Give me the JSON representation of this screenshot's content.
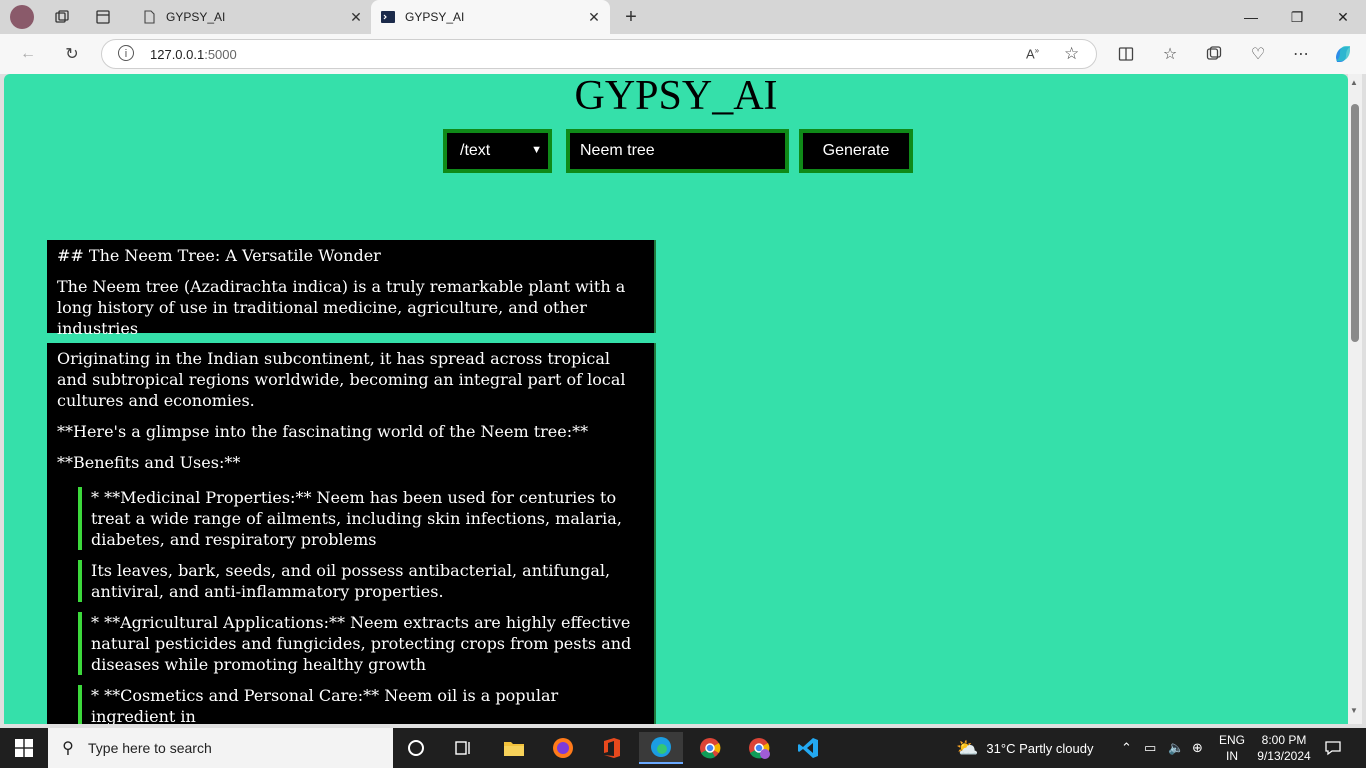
{
  "tabs": [
    {
      "title": "GYPSY_AI"
    },
    {
      "title": "GYPSY_AI"
    }
  ],
  "address": {
    "host": "127.0.0.1",
    "port": ":5000"
  },
  "page": {
    "title": "GYPSY_AI",
    "mode_value": "/text",
    "prompt_value": "Neem tree",
    "generate_label": "Generate"
  },
  "card1": {
    "heading": "## The Neem Tree: A Versatile Wonder",
    "intro": "The Neem tree (Azadirachta indica) is a truly remarkable plant with a long history of use in traditional medicine, agriculture, and other industries"
  },
  "card2": {
    "p1": "Originating in the Indian subcontinent, it has spread across tropical and subtropical regions worldwide, becoming an integral part of local cultures and economies.",
    "p2": "**Here's a glimpse into the fascinating world of the Neem tree:**",
    "p3": "**Benefits and Uses:**",
    "q1": "* **Medicinal Properties:** Neem has been used for centuries to treat a wide range of ailments, including skin infections, malaria, diabetes, and respiratory problems",
    "q2": "Its leaves, bark, seeds, and oil possess antibacterial, antifungal, antiviral, and anti-inflammatory properties.",
    "q3": "* **Agricultural Applications:** Neem extracts are highly effective natural pesticides and fungicides, protecting crops from pests and diseases while promoting healthy growth",
    "q4": "* **Cosmetics and Personal Care:** Neem oil is a popular ingredient in"
  },
  "taskbar": {
    "search_placeholder": "Type here to search",
    "weather": "31°C  Partly cloudy",
    "lang1": "ENG",
    "lang2": "IN",
    "time": "8:00 PM",
    "date": "9/13/2024"
  }
}
